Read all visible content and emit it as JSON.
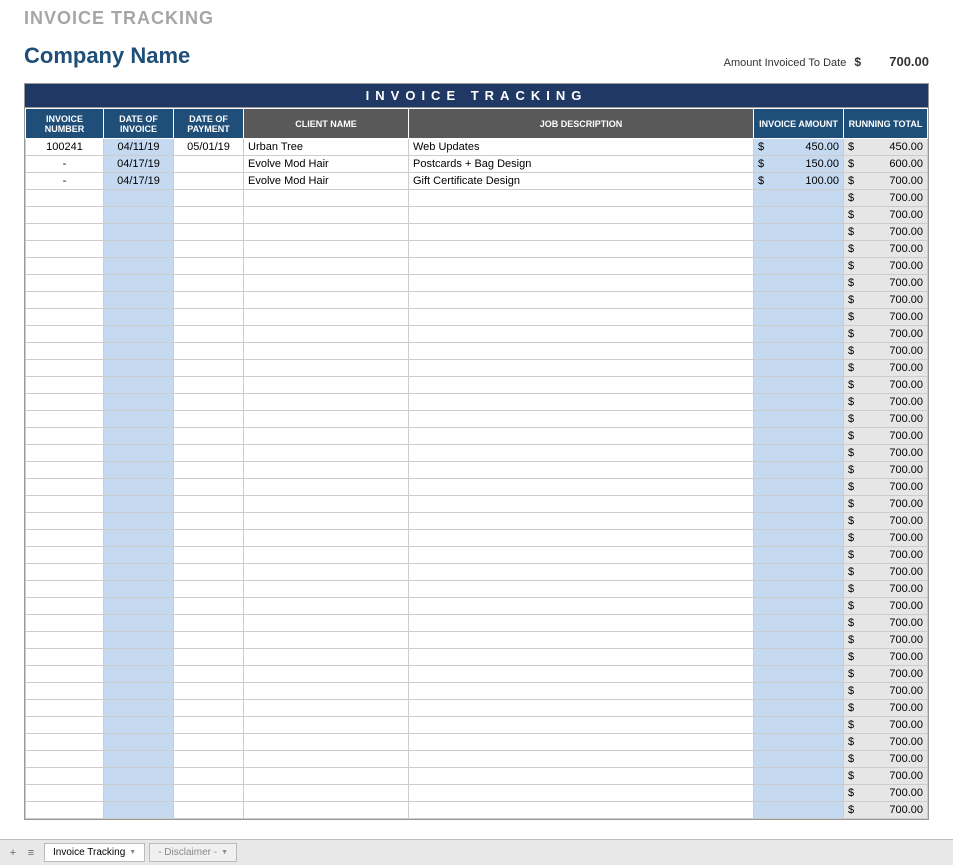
{
  "page_title": "INVOICE TRACKING",
  "company_name": "Company Name",
  "amount_invoiced_label": "Amount Invoiced To Date",
  "currency_symbol": "$",
  "amount_invoiced_value": "700.00",
  "banner_title": "INVOICE TRACKING",
  "columns": {
    "invoice_number": "INVOICE NUMBER",
    "date_of_invoice": "DATE OF INVOICE",
    "date_of_payment": "DATE OF PAYMENT",
    "client_name": "CLIENT NAME",
    "job_description": "JOB DESCRIPTION",
    "invoice_amount": "INVOICE AMOUNT",
    "running_total": "RUNNING TOTAL"
  },
  "rows": [
    {
      "num": "100241",
      "inv_date": "04/11/19",
      "pay_date": "05/01/19",
      "client": "Urban Tree",
      "desc": "Web Updates",
      "amount": "450.00",
      "running": "450.00"
    },
    {
      "num": "-",
      "inv_date": "04/17/19",
      "pay_date": "",
      "client": "Evolve Mod Hair",
      "desc": "Postcards + Bag Design",
      "amount": "150.00",
      "running": "600.00"
    },
    {
      "num": "-",
      "inv_date": "04/17/19",
      "pay_date": "",
      "client": "Evolve Mod Hair",
      "desc": "Gift Certificate Design",
      "amount": "100.00",
      "running": "700.00"
    },
    {
      "num": "",
      "inv_date": "",
      "pay_date": "",
      "client": "",
      "desc": "",
      "amount": "",
      "running": "700.00"
    },
    {
      "num": "",
      "inv_date": "",
      "pay_date": "",
      "client": "",
      "desc": "",
      "amount": "",
      "running": "700.00"
    },
    {
      "num": "",
      "inv_date": "",
      "pay_date": "",
      "client": "",
      "desc": "",
      "amount": "",
      "running": "700.00"
    },
    {
      "num": "",
      "inv_date": "",
      "pay_date": "",
      "client": "",
      "desc": "",
      "amount": "",
      "running": "700.00"
    },
    {
      "num": "",
      "inv_date": "",
      "pay_date": "",
      "client": "",
      "desc": "",
      "amount": "",
      "running": "700.00"
    },
    {
      "num": "",
      "inv_date": "",
      "pay_date": "",
      "client": "",
      "desc": "",
      "amount": "",
      "running": "700.00"
    },
    {
      "num": "",
      "inv_date": "",
      "pay_date": "",
      "client": "",
      "desc": "",
      "amount": "",
      "running": "700.00"
    },
    {
      "num": "",
      "inv_date": "",
      "pay_date": "",
      "client": "",
      "desc": "",
      "amount": "",
      "running": "700.00"
    },
    {
      "num": "",
      "inv_date": "",
      "pay_date": "",
      "client": "",
      "desc": "",
      "amount": "",
      "running": "700.00"
    },
    {
      "num": "",
      "inv_date": "",
      "pay_date": "",
      "client": "",
      "desc": "",
      "amount": "",
      "running": "700.00"
    },
    {
      "num": "",
      "inv_date": "",
      "pay_date": "",
      "client": "",
      "desc": "",
      "amount": "",
      "running": "700.00"
    },
    {
      "num": "",
      "inv_date": "",
      "pay_date": "",
      "client": "",
      "desc": "",
      "amount": "",
      "running": "700.00"
    },
    {
      "num": "",
      "inv_date": "",
      "pay_date": "",
      "client": "",
      "desc": "",
      "amount": "",
      "running": "700.00"
    },
    {
      "num": "",
      "inv_date": "",
      "pay_date": "",
      "client": "",
      "desc": "",
      "amount": "",
      "running": "700.00"
    },
    {
      "num": "",
      "inv_date": "",
      "pay_date": "",
      "client": "",
      "desc": "",
      "amount": "",
      "running": "700.00"
    },
    {
      "num": "",
      "inv_date": "",
      "pay_date": "",
      "client": "",
      "desc": "",
      "amount": "",
      "running": "700.00"
    },
    {
      "num": "",
      "inv_date": "",
      "pay_date": "",
      "client": "",
      "desc": "",
      "amount": "",
      "running": "700.00"
    },
    {
      "num": "",
      "inv_date": "",
      "pay_date": "",
      "client": "",
      "desc": "",
      "amount": "",
      "running": "700.00"
    },
    {
      "num": "",
      "inv_date": "",
      "pay_date": "",
      "client": "",
      "desc": "",
      "amount": "",
      "running": "700.00"
    },
    {
      "num": "",
      "inv_date": "",
      "pay_date": "",
      "client": "",
      "desc": "",
      "amount": "",
      "running": "700.00"
    },
    {
      "num": "",
      "inv_date": "",
      "pay_date": "",
      "client": "",
      "desc": "",
      "amount": "",
      "running": "700.00"
    },
    {
      "num": "",
      "inv_date": "",
      "pay_date": "",
      "client": "",
      "desc": "",
      "amount": "",
      "running": "700.00"
    },
    {
      "num": "",
      "inv_date": "",
      "pay_date": "",
      "client": "",
      "desc": "",
      "amount": "",
      "running": "700.00"
    },
    {
      "num": "",
      "inv_date": "",
      "pay_date": "",
      "client": "",
      "desc": "",
      "amount": "",
      "running": "700.00"
    },
    {
      "num": "",
      "inv_date": "",
      "pay_date": "",
      "client": "",
      "desc": "",
      "amount": "",
      "running": "700.00"
    },
    {
      "num": "",
      "inv_date": "",
      "pay_date": "",
      "client": "",
      "desc": "",
      "amount": "",
      "running": "700.00"
    },
    {
      "num": "",
      "inv_date": "",
      "pay_date": "",
      "client": "",
      "desc": "",
      "amount": "",
      "running": "700.00"
    },
    {
      "num": "",
      "inv_date": "",
      "pay_date": "",
      "client": "",
      "desc": "",
      "amount": "",
      "running": "700.00"
    },
    {
      "num": "",
      "inv_date": "",
      "pay_date": "",
      "client": "",
      "desc": "",
      "amount": "",
      "running": "700.00"
    },
    {
      "num": "",
      "inv_date": "",
      "pay_date": "",
      "client": "",
      "desc": "",
      "amount": "",
      "running": "700.00"
    },
    {
      "num": "",
      "inv_date": "",
      "pay_date": "",
      "client": "",
      "desc": "",
      "amount": "",
      "running": "700.00"
    },
    {
      "num": "",
      "inv_date": "",
      "pay_date": "",
      "client": "",
      "desc": "",
      "amount": "",
      "running": "700.00"
    },
    {
      "num": "",
      "inv_date": "",
      "pay_date": "",
      "client": "",
      "desc": "",
      "amount": "",
      "running": "700.00"
    },
    {
      "num": "",
      "inv_date": "",
      "pay_date": "",
      "client": "",
      "desc": "",
      "amount": "",
      "running": "700.00"
    },
    {
      "num": "",
      "inv_date": "",
      "pay_date": "",
      "client": "",
      "desc": "",
      "amount": "",
      "running": "700.00"
    },
    {
      "num": "",
      "inv_date": "",
      "pay_date": "",
      "client": "",
      "desc": "",
      "amount": "",
      "running": "700.00"
    },
    {
      "num": "",
      "inv_date": "",
      "pay_date": "",
      "client": "",
      "desc": "",
      "amount": "",
      "running": "700.00"
    }
  ],
  "sheet_tabs": {
    "active": "Invoice Tracking",
    "inactive": "- Disclaimer -"
  }
}
